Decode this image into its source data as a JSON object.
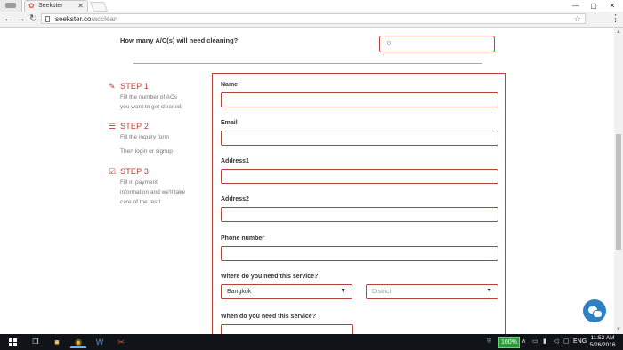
{
  "browser": {
    "tab_title": "Seekster",
    "tab_favicon": "✿",
    "tab_close": "✕",
    "url_host": "seekster.co",
    "url_path": "/acclean",
    "window_controls": [
      "—",
      "▢",
      "✕"
    ],
    "nav_icons": {
      "back": "←",
      "forward": "→",
      "reload": "↻"
    },
    "star": "☆",
    "menu": "⋮"
  },
  "question": {
    "label": "How many A/C(s) will need cleaning?",
    "count_value": "0"
  },
  "steps": [
    {
      "icon": "edit-icon",
      "glyph": "✎",
      "title": "STEP 1",
      "desc_lines": [
        "Fill the number of ACs",
        "you want to get cleaned"
      ]
    },
    {
      "icon": "list-icon",
      "glyph": "☰",
      "title": "STEP 2",
      "desc_lines": [
        "Fill the inquiry form",
        "Then login or signup"
      ]
    },
    {
      "icon": "checkbox-icon",
      "glyph": "☑",
      "title": "STEP 3",
      "desc_lines": [
        "Fill in payment",
        "information and we'll take",
        "care of the rest!"
      ]
    }
  ],
  "form": {
    "name_label": "Name",
    "email_label": "Email",
    "address1_label": "Address1",
    "address2_label": "Address2",
    "phone_label": "Phone number",
    "where_label": "Where do you need this service?",
    "province_value": "Bangkok",
    "district_placeholder": "District",
    "when_label": "When do you need this service?"
  },
  "taskbar": {
    "battery": "100%",
    "language": "ENG",
    "time": "11:52 AM",
    "date": "5/26/2016"
  },
  "colors": {
    "accent": "#c0392b",
    "border": "#b5443d",
    "chat": "#2f7fc1"
  }
}
